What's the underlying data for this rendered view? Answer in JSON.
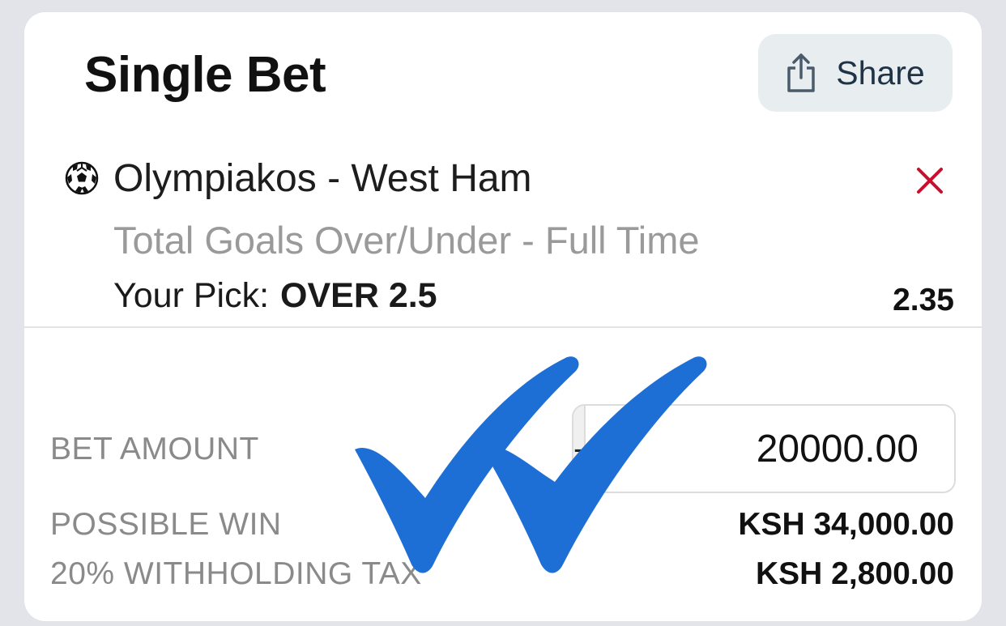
{
  "header": {
    "title": "Single Bet",
    "share_label": "Share"
  },
  "selection": {
    "sport_icon": "soccer-ball-icon",
    "match": "Olympiakos - West Ham",
    "market": "Total Goals Over/Under - Full Time",
    "pick_label": "Your Pick:",
    "pick_value": "OVER 2.5",
    "odds": "2.35",
    "remove_icon": "close-icon"
  },
  "bet": {
    "amount_label": "BET AMOUNT",
    "decrement_label": "-",
    "amount_value": "20000.00",
    "increment_label": "+",
    "possible_win_label": "POSSIBLE WIN",
    "possible_win_value": "KSH 34,000.00",
    "tax_label": "20% WITHHOLDING TAX",
    "tax_value": "KSH 2,800.00"
  },
  "overlay": {
    "icon": "double-checkmark-icon",
    "color": "#1d6fd6"
  },
  "colors": {
    "background": "#e2e4ea",
    "card": "#ffffff",
    "remove_accent": "#c8102e",
    "share_bg": "#e8edf0"
  }
}
